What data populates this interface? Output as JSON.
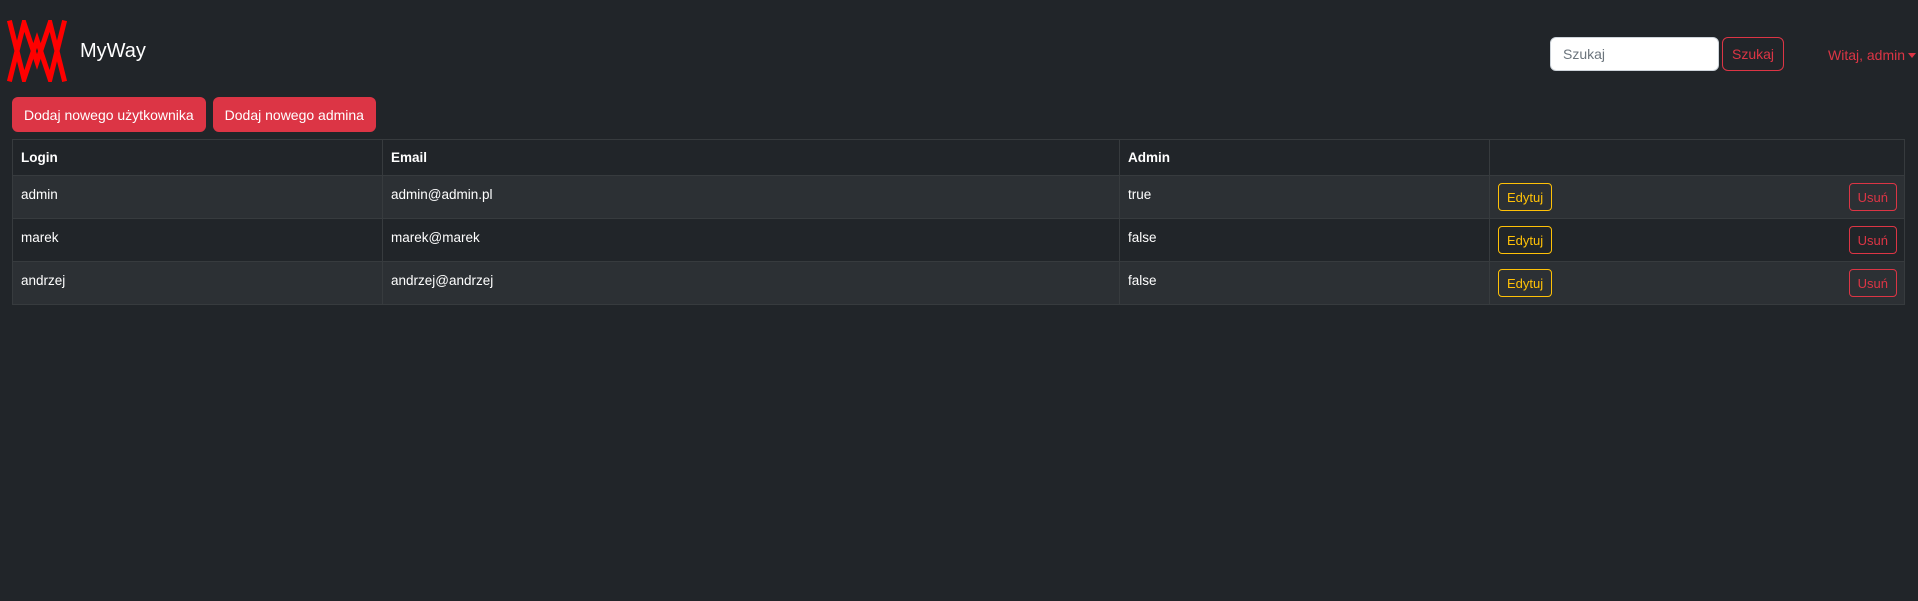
{
  "brand": {
    "name": "MyWay",
    "logo_icon": "myway-logo-icon",
    "logo_color": "#ff0000"
  },
  "search": {
    "placeholder": "Szukaj",
    "value": "",
    "button_label": "Szukaj"
  },
  "user_menu": {
    "label": "Witaj, admin"
  },
  "actions": {
    "add_user_label": "Dodaj nowego użytkownika",
    "add_admin_label": "Dodaj nowego admina"
  },
  "table": {
    "headers": [
      "Login",
      "Email",
      "Admin",
      ""
    ],
    "rows": [
      {
        "login": "admin",
        "email": "admin@admin.pl",
        "admin": "true",
        "edit_label": "Edytuj",
        "delete_label": "Usuń"
      },
      {
        "login": "marek",
        "email": "marek@marek",
        "admin": "false",
        "edit_label": "Edytuj",
        "delete_label": "Usuń"
      },
      {
        "login": "andrzej",
        "email": "andrzej@andrzej",
        "admin": "false",
        "edit_label": "Edytuj",
        "delete_label": "Usuń"
      }
    ]
  },
  "colors": {
    "background": "#212529",
    "danger": "#dc3545",
    "warning": "#ffc107"
  }
}
